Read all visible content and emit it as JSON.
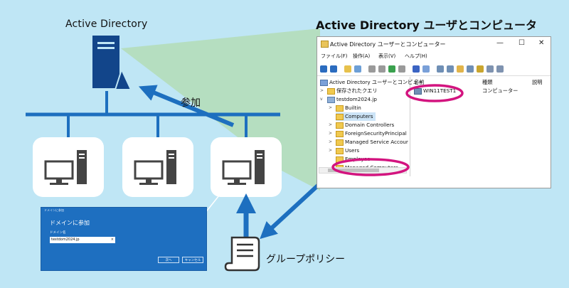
{
  "labels": {
    "active_directory": "Active Directory",
    "aduc_title": "Active Directory ユーザとコンピュータ",
    "join": "参加",
    "group_policy": "グループポリシー"
  },
  "dialog": {
    "title": "ドメインに参加",
    "heading": "ドメインに参加",
    "field_label": "ドメイン名",
    "field_value": "testdom2024.jp",
    "clear_glyph": "×",
    "next_label": "次へ",
    "cancel_label": "キャンセル"
  },
  "window": {
    "title": "Active Directory ユーザーとコンピューター",
    "minimize": "—",
    "maximize": "☐",
    "close": "✕",
    "menu": [
      "ファイル(F)",
      "操作(A)",
      "表示(V)",
      "ヘルプ(H)"
    ],
    "tree": [
      "Active Directory ユーザーとコンピュー",
      "保存されたクエリ",
      "testdom2024.jp",
      "Builtin",
      "Computers",
      "Domain Controllers",
      "ForeignSecurityPrincipal",
      "Managed Service Accour",
      "Users",
      "Employee",
      "Managed Computers"
    ],
    "columns": [
      "名前",
      "種類",
      "説明"
    ],
    "rows": [
      {
        "name": "WIN11TEST1",
        "type": "コンピューター",
        "desc": ""
      }
    ]
  },
  "colors": {
    "background": "#bfe6f5",
    "arrow": "#1d6fbf",
    "server": "#12458a",
    "highlight": "#d3147f",
    "beam": "#b3dcb6"
  }
}
